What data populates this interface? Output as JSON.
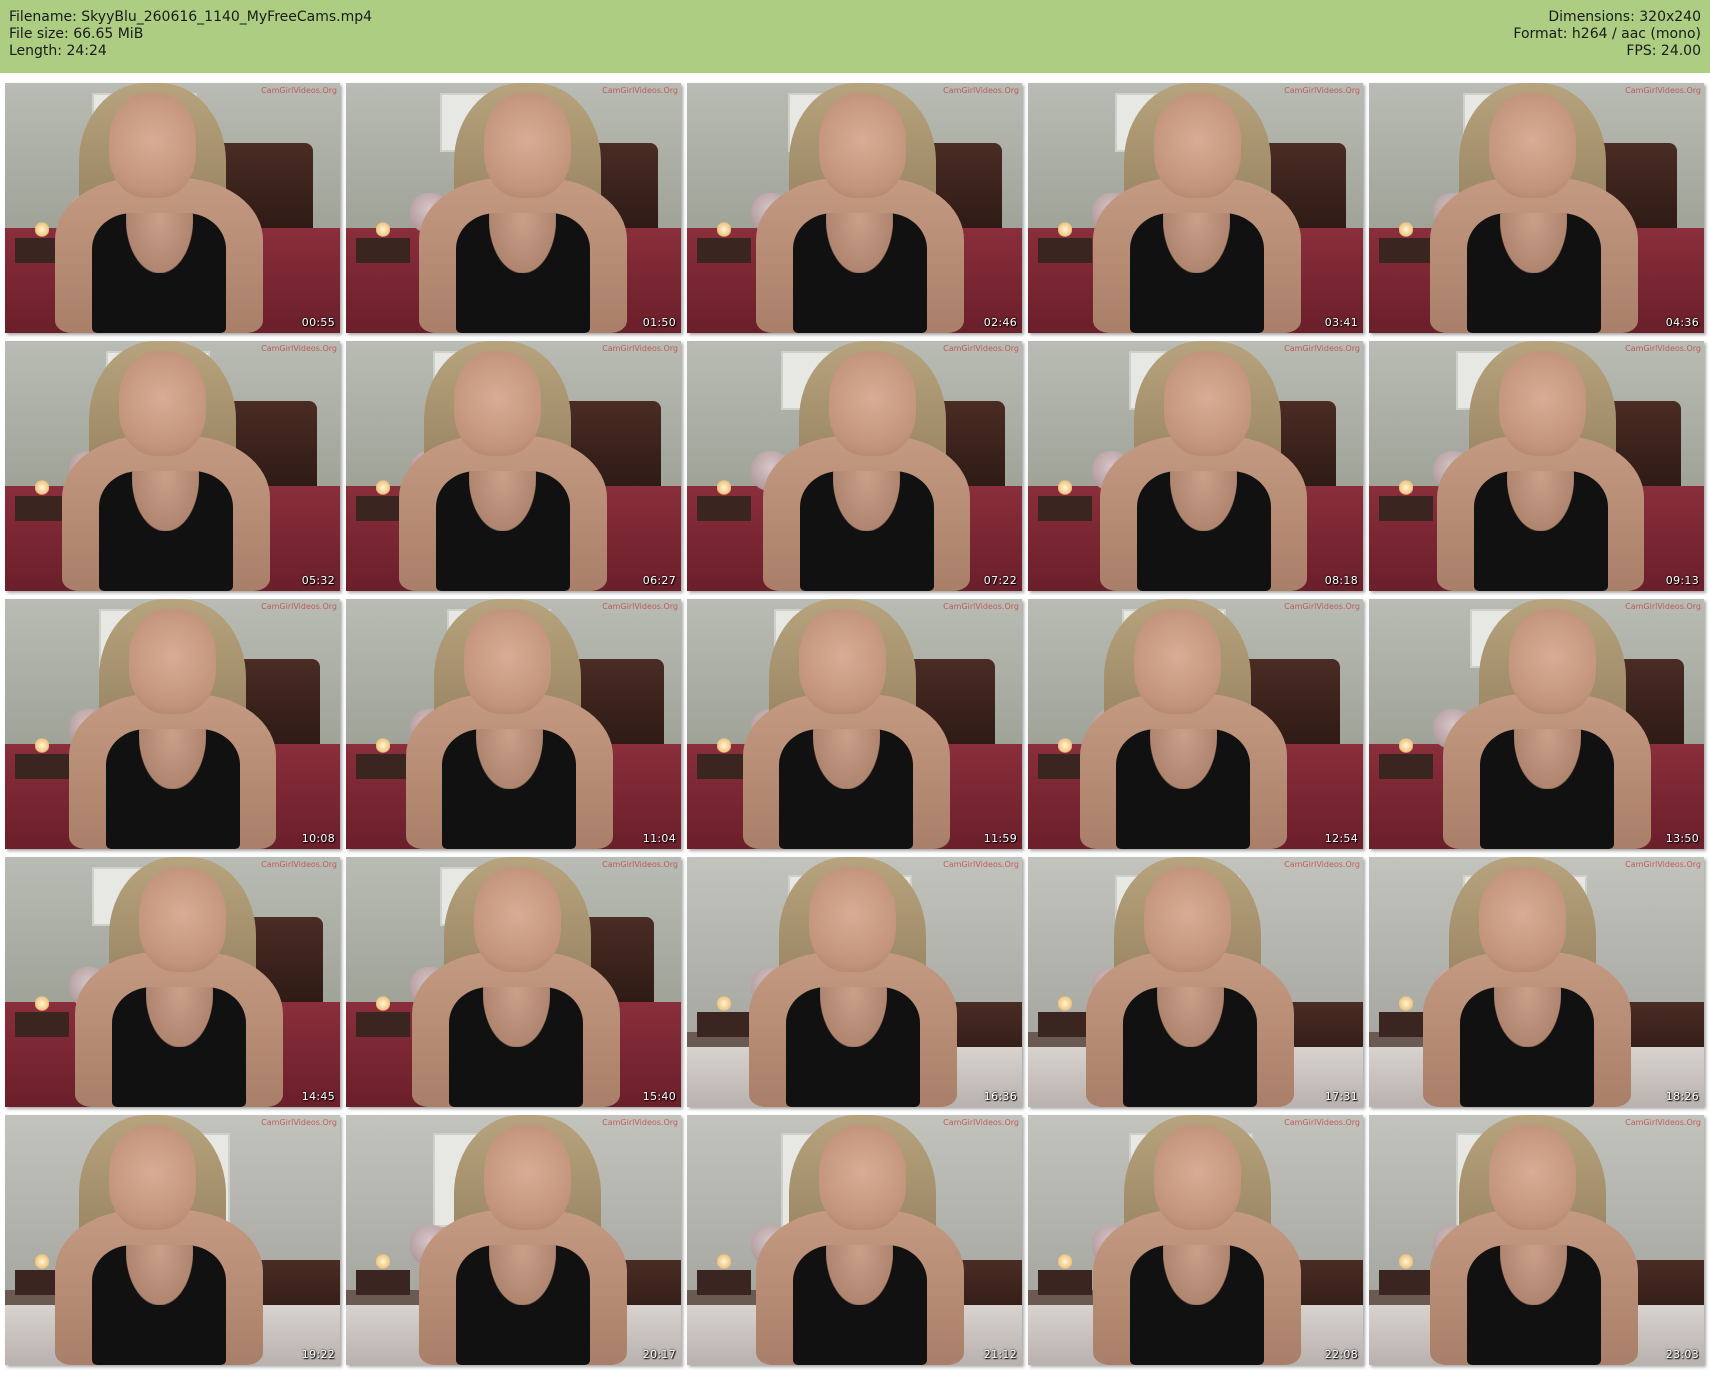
{
  "header": {
    "filename": "Filename: SkyyBlu_260616_1140_MyFreeCams.mp4",
    "filesize": "File size: 66.65 MiB",
    "length": "Length: 24:24",
    "dimensions": "Dimensions: 320x240",
    "format": "Format: h264 / aac (mono)",
    "fps": "FPS: 24.00"
  },
  "colors": {
    "header_bg": "#adce82",
    "page_bg": "#ffffff",
    "timestamp": "#ffffff"
  },
  "thumbnails": [
    {
      "timestamp": "00:55",
      "watermark": "CamGirlVideos.Org"
    },
    {
      "timestamp": "01:50",
      "watermark": "CamGirlVideos.Org"
    },
    {
      "timestamp": "02:46",
      "watermark": "CamGirlVideos.Org"
    },
    {
      "timestamp": "03:41",
      "watermark": "CamGirlVideos.Org"
    },
    {
      "timestamp": "04:36",
      "watermark": "CamGirlVideos.Org"
    },
    {
      "timestamp": "05:32",
      "watermark": "CamGirlVideos.Org"
    },
    {
      "timestamp": "06:27",
      "watermark": "CamGirlVideos.Org"
    },
    {
      "timestamp": "07:22",
      "watermark": "CamGirlVideos.Org"
    },
    {
      "timestamp": "08:18",
      "watermark": "CamGirlVideos.Org"
    },
    {
      "timestamp": "09:13",
      "watermark": "CamGirlVideos.Org"
    },
    {
      "timestamp": "10:08",
      "watermark": "CamGirlVideos.Org"
    },
    {
      "timestamp": "11:04",
      "watermark": "CamGirlVideos.Org"
    },
    {
      "timestamp": "11:59",
      "watermark": "CamGirlVideos.Org"
    },
    {
      "timestamp": "12:54",
      "watermark": "CamGirlVideos.Org"
    },
    {
      "timestamp": "13:50",
      "watermark": "CamGirlVideos.Org"
    },
    {
      "timestamp": "14:45",
      "watermark": "CamGirlVideos.Org"
    },
    {
      "timestamp": "15:40",
      "watermark": "CamGirlVideos.Org"
    },
    {
      "timestamp": "16:36",
      "watermark": "CamGirlVideos.Org"
    },
    {
      "timestamp": "17:31",
      "watermark": "CamGirlVideos.Org"
    },
    {
      "timestamp": "18:26",
      "watermark": "CamGirlVideos.Org"
    },
    {
      "timestamp": "19:22",
      "watermark": "CamGirlVideos.Org"
    },
    {
      "timestamp": "20:17",
      "watermark": "CamGirlVideos.Org"
    },
    {
      "timestamp": "21:12",
      "watermark": "CamGirlVideos.Org"
    },
    {
      "timestamp": "22:08",
      "watermark": "CamGirlVideos.Org"
    },
    {
      "timestamp": "23:03",
      "watermark": "CamGirlVideos.Org"
    }
  ]
}
